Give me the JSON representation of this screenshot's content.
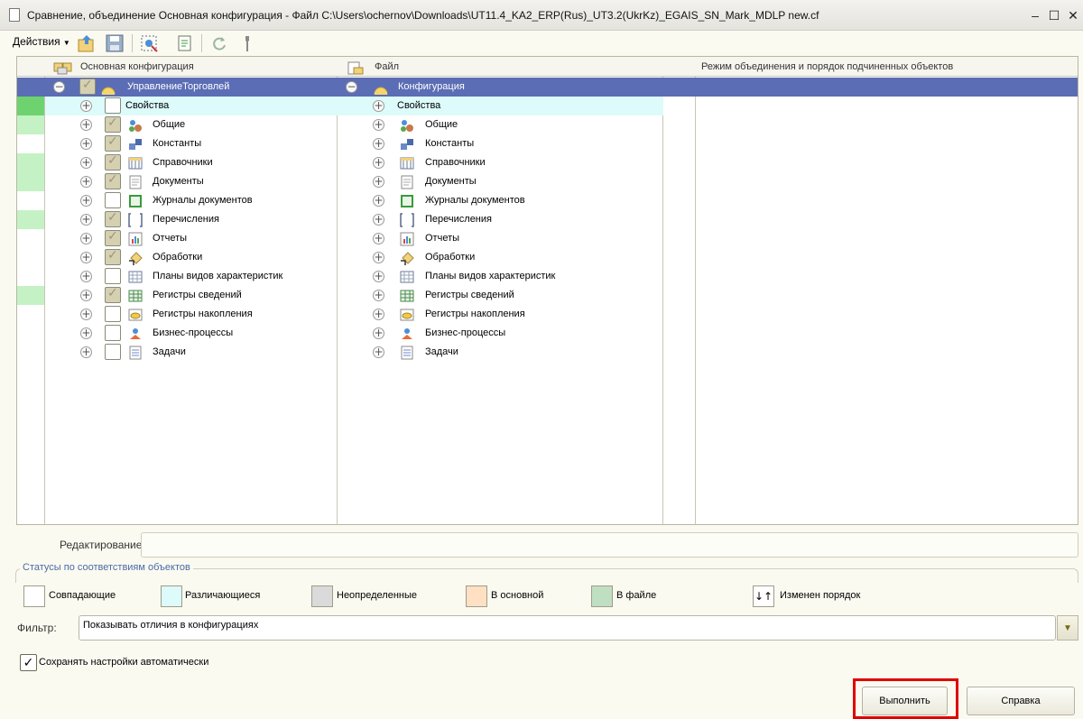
{
  "window": {
    "title": "Сравнение, объединение Основная конфигурация - Файл C:\\Users\\ochernov\\Downloads\\UT11.4_KA2_ERP(Rus)_UT3.2(UkrKz)_EGAIS_SN_Mark_MDLP new.cf",
    "minimize": "–",
    "maximize": "☐",
    "close": "✕"
  },
  "toolbar": {
    "actions_label": "Действия"
  },
  "grid": {
    "columns": [
      "Основная конфигурация",
      "Файл",
      "",
      "Режим объединения и порядок подчиненных объектов"
    ],
    "root_main": "УправлениеТорговлей",
    "root_file": "Конфигурация",
    "items": [
      "Свойства",
      "Общие",
      "Константы",
      "Справочники",
      "Документы",
      "Журналы документов",
      "Перечисления",
      "Отчеты",
      "Обработки",
      "Планы видов характеристик",
      "Регистры сведений",
      "Регистры накопления",
      "Бизнес-процессы",
      "Задачи"
    ]
  },
  "editing": {
    "label": "Редактирование:",
    "value": ""
  },
  "statuses": {
    "title": "Статусы по соответствиям объектов",
    "items": [
      {
        "label": "Совпадающие",
        "color": "#ffffff"
      },
      {
        "label": "Различающиеся",
        "color": "#dcfbfa"
      },
      {
        "label": "Неопределенные",
        "color": "#dadada"
      },
      {
        "label": "В основной",
        "color": "#ffe0c2"
      },
      {
        "label": "В файле",
        "color": "#bfdfc2"
      },
      {
        "label": "Изменен порядок",
        "glyph": "↓↑"
      }
    ]
  },
  "filter": {
    "label": "Фильтр:",
    "value": "Показывать отличия в конфигурациях"
  },
  "save_settings": {
    "label": "Сохранять настройки автоматически",
    "checked": true
  },
  "buttons": {
    "execute": "Выполнить",
    "help": "Справка"
  },
  "colors": {
    "selection": "#5b6db5",
    "differs": "#dcfbfa",
    "in_file": "#bfdfc2",
    "highlight": "#e00000"
  }
}
